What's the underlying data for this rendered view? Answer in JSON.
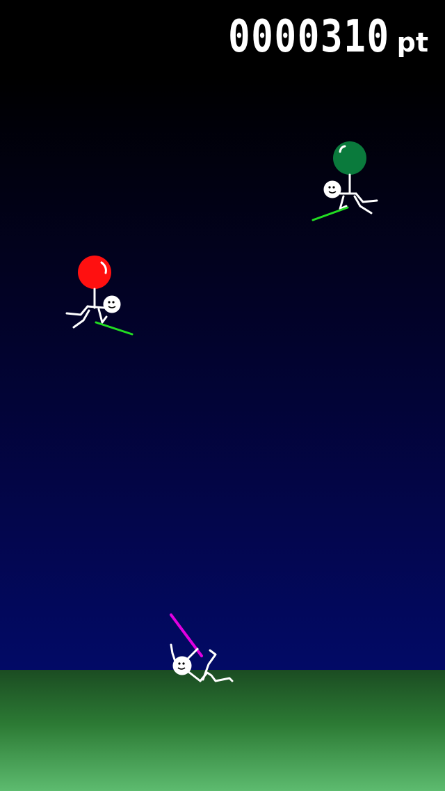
{
  "hud": {
    "score": "0000310",
    "score_unit": "pt"
  },
  "colors": {
    "sky_top": "#000000",
    "sky_bottom": "#020a66",
    "ground_top": "#1b4c22",
    "ground_bottom": "#5dbb6f",
    "red_balloon": "#ff1010",
    "green_balloon": "#0a7a3c",
    "enemy_lance": "#22dd22",
    "player_lance": "#e000e0",
    "figure": "#ffffff"
  },
  "entities": {
    "enemy_red_balloon": "red-balloon-enemy",
    "enemy_green_balloon": "green-balloon-enemy",
    "player": "player-stick-figure"
  }
}
